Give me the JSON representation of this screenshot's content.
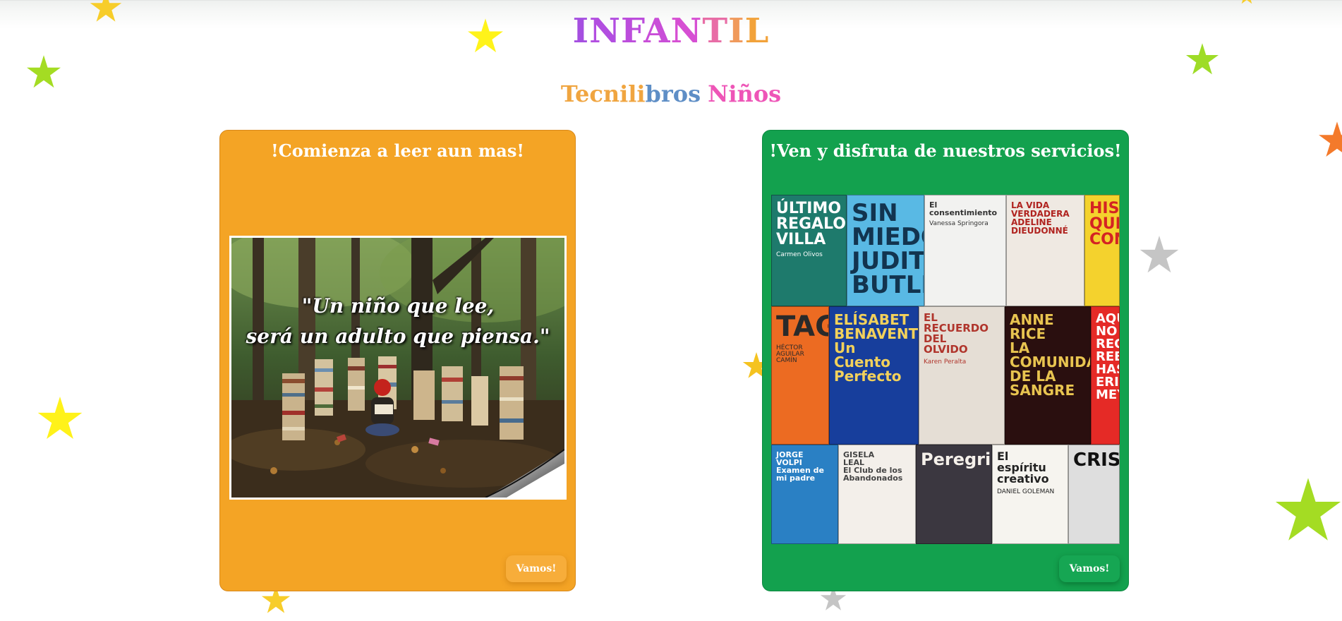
{
  "header": {
    "title_letters": [
      {
        "ch": "I",
        "color": "#a54fe0"
      },
      {
        "ch": "N",
        "color": "#b24ee0"
      },
      {
        "ch": "F",
        "color": "#bc4ddc"
      },
      {
        "ch": "A",
        "color": "#c94ed8"
      },
      {
        "ch": "N",
        "color": "#d64fd3"
      },
      {
        "ch": "T",
        "color": "#e86da6"
      },
      {
        "ch": "I",
        "color": "#f09a5c"
      },
      {
        "ch": "L",
        "color": "#f2a23a"
      }
    ],
    "subtitle_part1": "Tecnili",
    "subtitle_part2": "bros",
    "subtitle_part3": "Niños",
    "subtitle_colors": {
      "part1": "#f0a540",
      "part2": "#5e8ec6",
      "part3": "#ee55b7"
    }
  },
  "cards": [
    {
      "title": "!Comienza a leer aun mas!",
      "button": "Vamos!",
      "color": "#f4a425",
      "image": {
        "quote_line1": "\"Un niño que lee,",
        "quote_line2": "será un adulto que piensa.\""
      }
    },
    {
      "title": "!Ven y disfruta de nuestros servicios!",
      "button": "Vamos!",
      "color": "#13a14e",
      "books": [
        {
          "text": [
            "ÚLTIMO",
            "REGALO",
            "VILLA"
          ],
          "sub": "Carmen Olivos",
          "bg": "#1e7a6c",
          "fg": "#ffffff"
        },
        {
          "text": [
            "SIN",
            "MIEDO",
            "JUDITH",
            "BUTLER"
          ],
          "sub": "",
          "bg": "#59b9e4",
          "fg": "#12344f"
        },
        {
          "text": [
            "El consentimiento"
          ],
          "sub": "Vanessa Springora",
          "bg": "#f2f2f0",
          "fg": "#333333"
        },
        {
          "text": [
            "LA VIDA",
            "VERDADERA",
            "ADELINE",
            "DIEUDONNÉ"
          ],
          "sub": "",
          "bg": "#efe9e2",
          "fg": "#b0231f"
        },
        {
          "text": [
            "HIS",
            "QUE",
            "CON"
          ],
          "sub": "",
          "bg": "#f4d22d",
          "fg": "#d42323"
        },
        {
          "text": [
            "TAGIO"
          ],
          "sub": "HÉCTOR AGUILAR CAMÍN",
          "bg": "#ec6b22",
          "fg": "#2a2a2a"
        },
        {
          "text": [
            "ELÍSABET",
            "BENAVENT",
            "Un",
            "Cuento",
            "Perfecto"
          ],
          "sub": "",
          "bg": "#173e9c",
          "fg": "#f2d15b"
        },
        {
          "text": [
            "EL",
            "RECUERDO",
            "DEL",
            "OLVIDO"
          ],
          "sub": "Karen Peralta",
          "bg": "#e5ded5",
          "fg": "#b0352c"
        },
        {
          "text": [
            "ANNE",
            "RICE",
            "LA",
            "COMUNIDAD",
            "DE LA",
            "SANGRE"
          ],
          "sub": "",
          "bg": "#2a0f0f",
          "fg": "#e8c450"
        },
        {
          "text": [
            "AQU",
            "NO",
            "REC",
            "REE",
            "HAS",
            "ERIN",
            "MEY"
          ],
          "sub": "",
          "bg": "#e52a26",
          "fg": "#ffffff"
        },
        {
          "text": [
            "JORGE",
            "VOLPI",
            "Examen de",
            "mi padre"
          ],
          "sub": "",
          "bg": "#2a80c4",
          "fg": "#ffffff"
        },
        {
          "text": [
            "GISELA",
            "LEAL",
            "El Club de los",
            "Abandonados"
          ],
          "sub": "",
          "bg": "#f3efea",
          "fg": "#444444"
        },
        {
          "text": [
            "Peregrina"
          ],
          "sub": "",
          "bg": "#3b3740",
          "fg": "#f5f0ea"
        },
        {
          "text": [
            "El",
            "espíritu",
            "creativo"
          ],
          "sub": "DANIEL GOLEMAN",
          "bg": "#f6f4ef",
          "fg": "#222222"
        },
        {
          "text": [
            "CRISIS"
          ],
          "sub": "",
          "bg": "#dedede",
          "fg": "#111111"
        }
      ]
    }
  ],
  "icons": {
    "stars": [
      "star-icon"
    ]
  }
}
